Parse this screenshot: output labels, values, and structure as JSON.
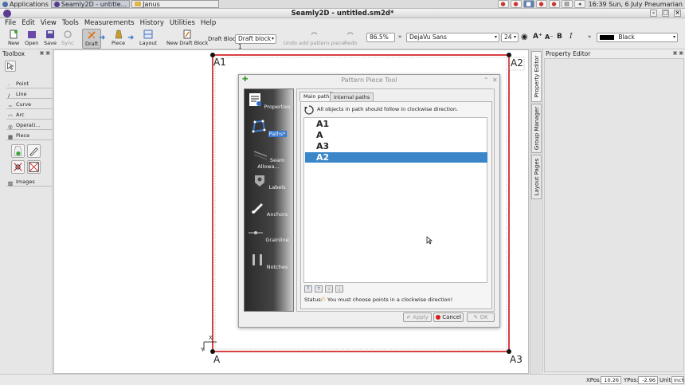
{
  "system_panel": {
    "applications_label": "Applications",
    "tasks": [
      {
        "label": "Seamly2D - untitle..."
      },
      {
        "label": "Janus"
      }
    ],
    "clock": "16:39",
    "date": "Sun, 6 July",
    "user": "Pneumarian"
  },
  "window": {
    "title": "Seamly2D - untitled.sm2d*"
  },
  "menubar": [
    "File",
    "Edit",
    "View",
    "Tools",
    "Measurements",
    "History",
    "Utilities",
    "Help"
  ],
  "toolbar": {
    "new": "New",
    "open": "Open",
    "save": "Save",
    "sync": "Sync",
    "draft": "Draft",
    "piece": "Piece",
    "layout": "Layout",
    "new_draft_block": "New Draft Block",
    "draft_block_label": "Draft Block:",
    "draft_block_value": "Draft block 1",
    "undo": "Undo add pattern piece",
    "redo": "Redo",
    "zoom": "86.5%",
    "font": "DejaVu Sans",
    "font_size": "24",
    "line_color": "Black"
  },
  "toolbox": {
    "title": "Toolbox",
    "groups": [
      "Point",
      "Line",
      "Curve",
      "Arc",
      "Operati...",
      "Piece",
      "Images"
    ]
  },
  "canvas": {
    "labels": {
      "a1": "A1",
      "a2": "A2",
      "a": "A",
      "a3": "A3"
    },
    "axis": {
      "x": "X",
      "y": "Y"
    }
  },
  "right_tabs": [
    "Property Editor",
    "Group Manager",
    "Layout Pages"
  ],
  "property_editor": {
    "title": "Property Editor"
  },
  "statusbar": {
    "xpos_label": "XPos:",
    "xpos": "10.26",
    "ypos_label": "YPos:",
    "ypos": "-2.96",
    "units_label": "Units:",
    "units": "inch"
  },
  "dialog": {
    "title": "Pattern Piece Tool",
    "side_items": [
      "Properties",
      "Paths*",
      "Seam Allowa...",
      "Labels",
      "Anchors",
      "Grainline",
      "Notches"
    ],
    "tabs": [
      "Main path",
      "Internal paths"
    ],
    "hint": "All objects in path should follow in clockwise direction.",
    "path_items": [
      "A1",
      "A",
      "A3",
      "A2"
    ],
    "selected_index": 3,
    "status_label": "Status:",
    "status_text": "You must choose points in a clockwise direction!",
    "buttons": {
      "apply": "Apply",
      "cancel": "Cancel",
      "ok": "OK"
    }
  },
  "colors": {
    "accent": "#3a86c8",
    "piece_outline": "#cc0000",
    "cancel_icon": "#d42020"
  }
}
